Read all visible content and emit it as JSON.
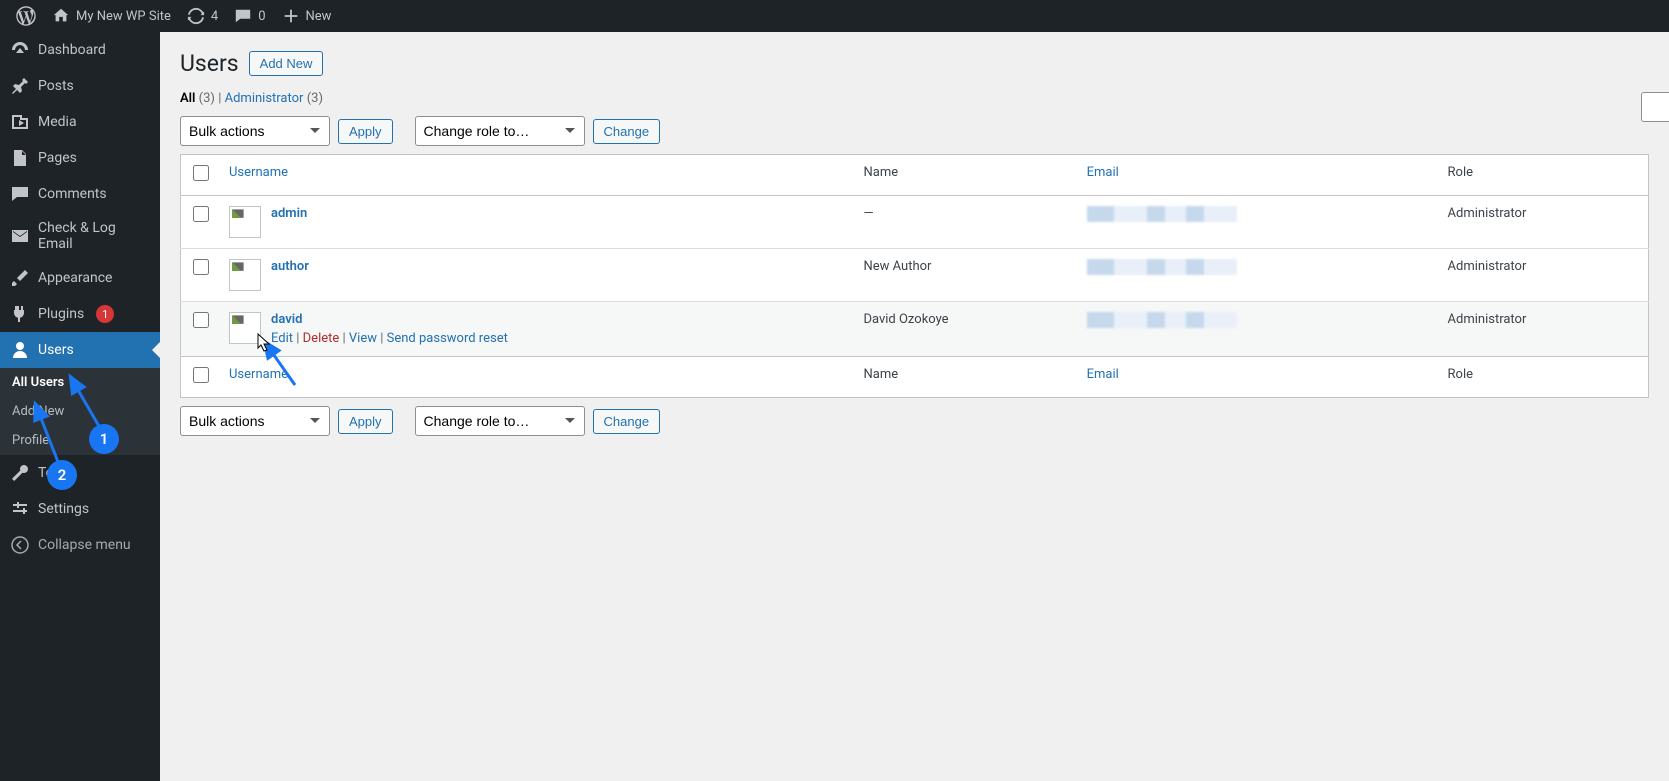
{
  "topbar": {
    "site_name": "My New WP Site",
    "updates_count": "4",
    "comments_count": "0",
    "new_label": "New"
  },
  "sidebar": {
    "items": [
      {
        "label": "Dashboard",
        "icon": "dashboard"
      },
      {
        "label": "Posts",
        "icon": "pin"
      },
      {
        "label": "Media",
        "icon": "media"
      },
      {
        "label": "Pages",
        "icon": "page"
      },
      {
        "label": "Comments",
        "icon": "comment"
      },
      {
        "label": "Check & Log Email",
        "icon": "mail"
      },
      {
        "label": "Appearance",
        "icon": "brush"
      },
      {
        "label": "Plugins",
        "icon": "plug",
        "badge": "1"
      },
      {
        "label": "Users",
        "icon": "user",
        "current": true
      },
      {
        "label": "Tools",
        "icon": "wrench"
      },
      {
        "label": "Settings",
        "icon": "sliders"
      }
    ],
    "submenu": [
      {
        "label": "All Users",
        "current": true
      },
      {
        "label": "Add New"
      },
      {
        "label": "Profile"
      }
    ],
    "collapse": "Collapse menu"
  },
  "page": {
    "title": "Users",
    "add_new": "Add New",
    "filters": {
      "all_label": "All",
      "all_count": "(3)",
      "sep": " | ",
      "admin_label": "Administrator",
      "admin_count": "(3)"
    },
    "bulk_label": "Bulk actions",
    "apply": "Apply",
    "role_label": "Change role to…",
    "change": "Change",
    "cols": {
      "username": "Username",
      "name": "Name",
      "email": "Email",
      "role": "Role"
    },
    "rows": [
      {
        "username": "admin",
        "name": "—",
        "role": "Administrator"
      },
      {
        "username": "author",
        "name": "New Author",
        "role": "Administrator"
      },
      {
        "username": "david",
        "name": "David Ozokoye",
        "role": "Administrator",
        "hover": true
      }
    ],
    "row_actions": {
      "edit": "Edit",
      "delete": "Delete",
      "view": "View",
      "reset": "Send password reset"
    }
  },
  "annotations": {
    "a1": "1",
    "a2": "2"
  }
}
